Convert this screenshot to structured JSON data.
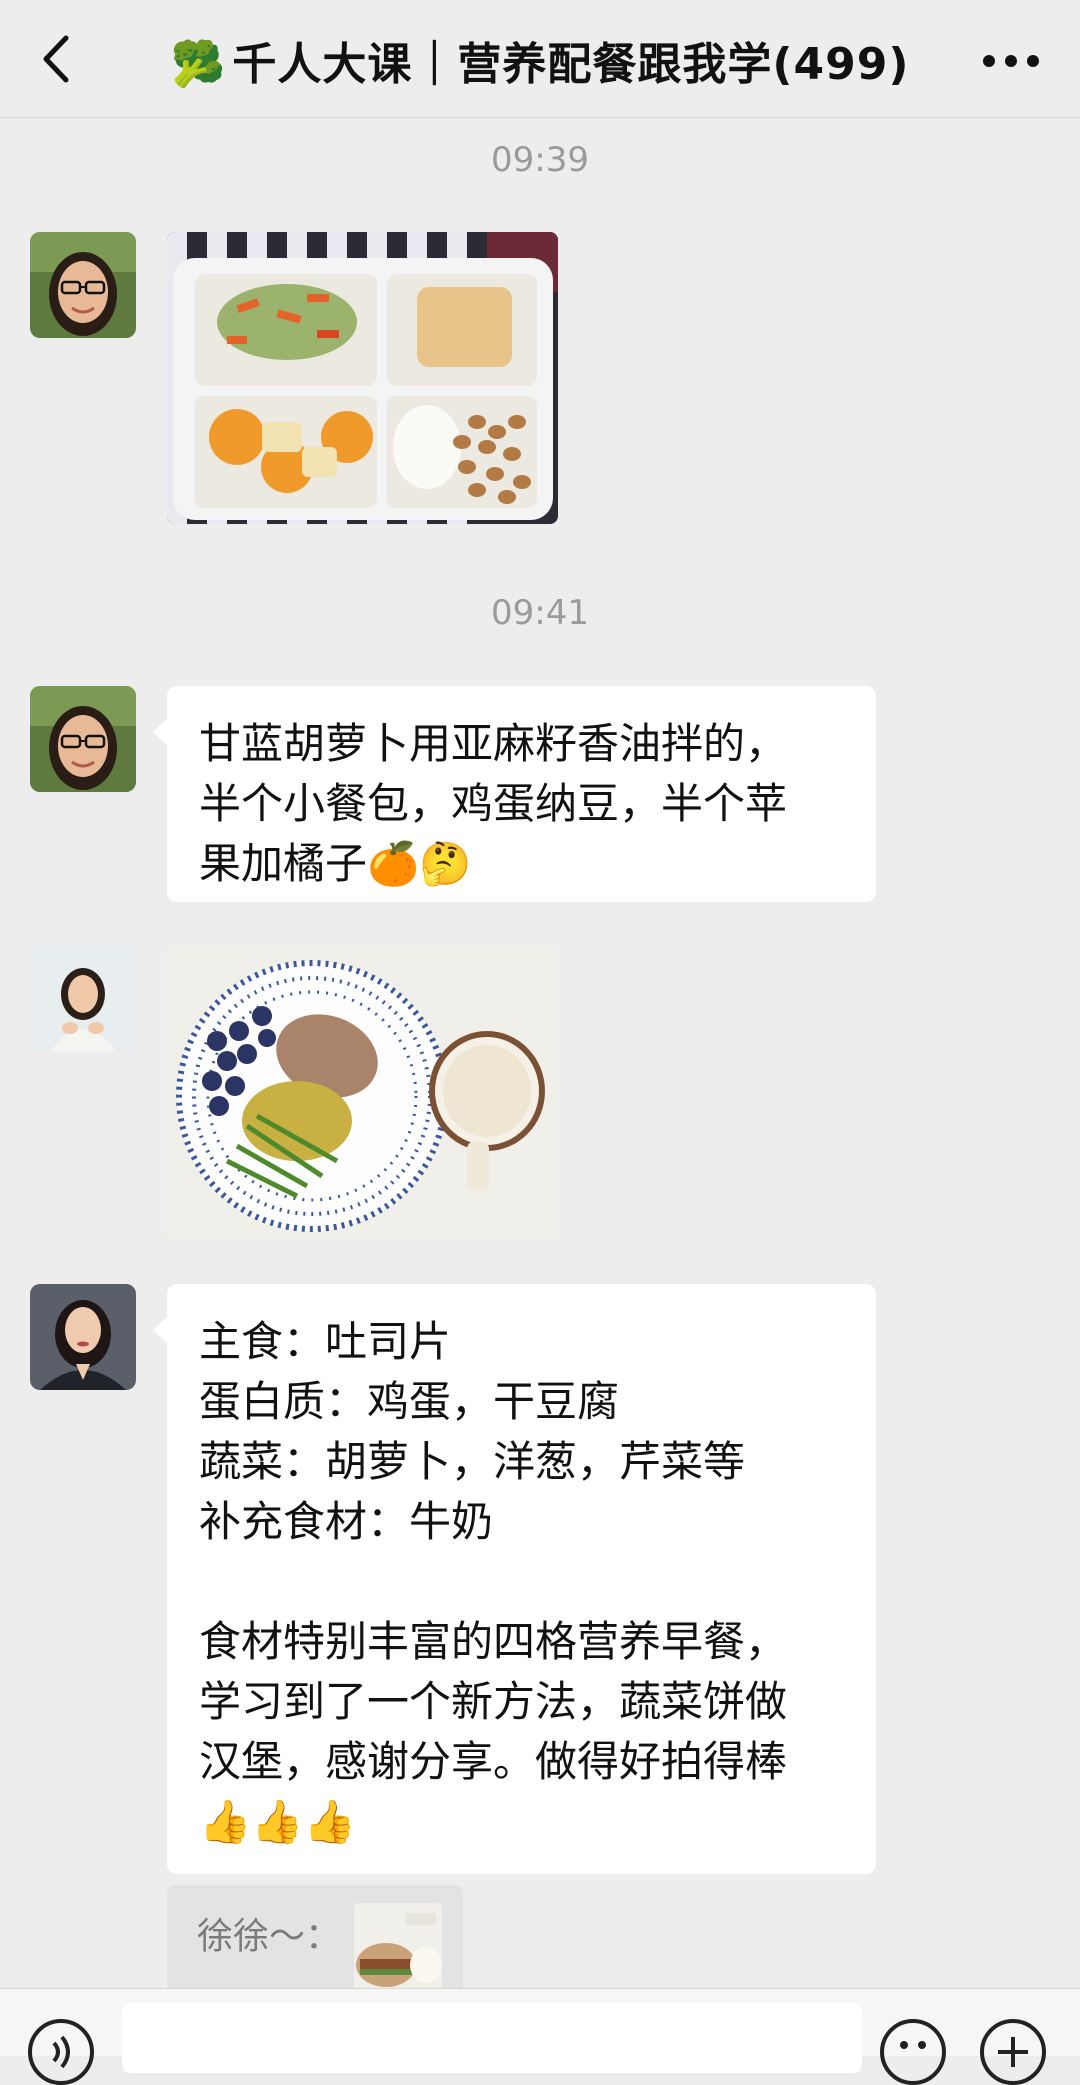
{
  "header": {
    "title_emoji": "🥦",
    "title": "千人大课｜营养配餐跟我学(499)"
  },
  "timestamps": [
    "09:39",
    "09:41"
  ],
  "messages": {
    "m2": {
      "lines": [
        "甘蓝胡萝卜用亚麻籽香油拌的，",
        "半个小餐包，鸡蛋纳豆，半个苹",
        "果加橘子🍊🤔"
      ]
    },
    "m4": {
      "lines": [
        "主食：吐司片",
        "蛋白质：鸡蛋，干豆腐",
        "蔬菜：胡萝卜，洋葱，芹菜等",
        "补充食材：牛奶",
        "",
        "食材特别丰富的四格营养早餐，",
        "学习到了一个新方法，蔬菜饼做",
        "汉堡，感谢分享。做得好拍得棒",
        "👍👍👍"
      ]
    }
  },
  "quote": {
    "text": "徐徐～："
  },
  "icons": {
    "back": "chevron-left-icon",
    "more": "more-dots-icon",
    "voice": "voice-icon",
    "emoji": "emoji-icon",
    "plus": "plus-icon"
  },
  "colors": {
    "background": "#ededed",
    "bubble": "#ffffff",
    "timestamp": "#9a9a9a"
  }
}
